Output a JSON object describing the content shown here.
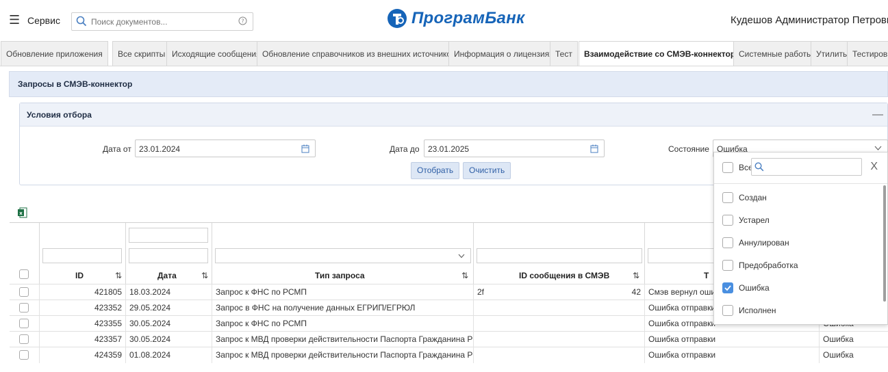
{
  "header": {
    "menu_icon": "hamburger-icon",
    "service_label": "Сервис",
    "search_placeholder": "Поиск документов...",
    "logo_text": "ПрограмБанк",
    "user_name": "Кудешов Администратор Петрович"
  },
  "tabs": [
    {
      "label": "Обновление приложения",
      "active": false
    },
    {
      "label": "Все скрипты",
      "active": false
    },
    {
      "label": "Исходящие сообщения",
      "active": false
    },
    {
      "label": "Обновление справочников из внешних источников",
      "active": false
    },
    {
      "label": "Информация о лицензиях",
      "active": false
    },
    {
      "label": "Тест",
      "active": false
    },
    {
      "label": "Взаимодействие со СМЭВ-коннектором",
      "active": true
    },
    {
      "label": "Системные работы",
      "active": false
    },
    {
      "label": "Утилиты",
      "active": false
    },
    {
      "label": "Тестиров",
      "active": false
    }
  ],
  "panel": {
    "title": "Запросы в СМЭВ-коннектор"
  },
  "filter": {
    "title": "Условия отбора",
    "collapse_symbol": "—",
    "date_from_label": "Дата от",
    "date_from_value": "23.01.2024",
    "date_to_label": "Дата до",
    "date_to_value": "23.01.2025",
    "state_label": "Состояние",
    "state_value": "Ошибка",
    "apply_button": "Отобрать",
    "clear_button": "Очистить"
  },
  "dropdown": {
    "all_label": "Все",
    "close_symbol": "X",
    "options": [
      {
        "label": "Создан",
        "checked": false
      },
      {
        "label": "Устарел",
        "checked": false
      },
      {
        "label": "Аннулирован",
        "checked": false
      },
      {
        "label": "Предобработка",
        "checked": false
      },
      {
        "label": "Ошибка",
        "checked": true
      },
      {
        "label": "Исполнен",
        "checked": false
      }
    ]
  },
  "table": {
    "columns": {
      "id": "ID",
      "date": "Дата",
      "type": "Тип запроса",
      "smev_id": "ID сообщения в СМЭВ",
      "col5_partial": "Т"
    },
    "sort_symbol": "⇅",
    "rows": [
      {
        "id": "421805",
        "date": "18.03.2024",
        "type": "Запрос к ФНС по РСМП",
        "smev_id_a": "2f",
        "smev_id_b": "42",
        "col5": "Смэв вернул ошибк",
        "col6": ""
      },
      {
        "id": "423352",
        "date": "29.05.2024",
        "type": "Запрос в ФНС на получение данных ЕГРИП/ЕГРЮЛ",
        "smev_id_a": "",
        "smev_id_b": "",
        "col5": "Ошибка отправки",
        "col6": ""
      },
      {
        "id": "423355",
        "date": "30.05.2024",
        "type": "Запрос к ФНС по РСМП",
        "smev_id_a": "",
        "smev_id_b": "",
        "col5": "Ошибка отправки",
        "col6": "Ошибка"
      },
      {
        "id": "423357",
        "date": "30.05.2024",
        "type": "Запрос к МВД проверки действительности Паспорта Гражданина РФ для бан",
        "smev_id_a": "",
        "smev_id_b": "",
        "col5": "Ошибка отправки",
        "col6": "Ошибка"
      },
      {
        "id": "424359",
        "date": "01.08.2024",
        "type": "Запрос к МВД проверки действительности Паспорта Гражданина РФ для бан",
        "smev_id_a": "",
        "smev_id_b": "",
        "col5": "Ошибка отправки",
        "col6": "Ошибка"
      }
    ]
  },
  "colors": {
    "accent": "#1664b8",
    "panel_header_bg": "#e4ebf7",
    "button_bg": "#dde7f5",
    "checkbox_checked": "#4a8fe0",
    "excel_green": "#1d7044"
  }
}
